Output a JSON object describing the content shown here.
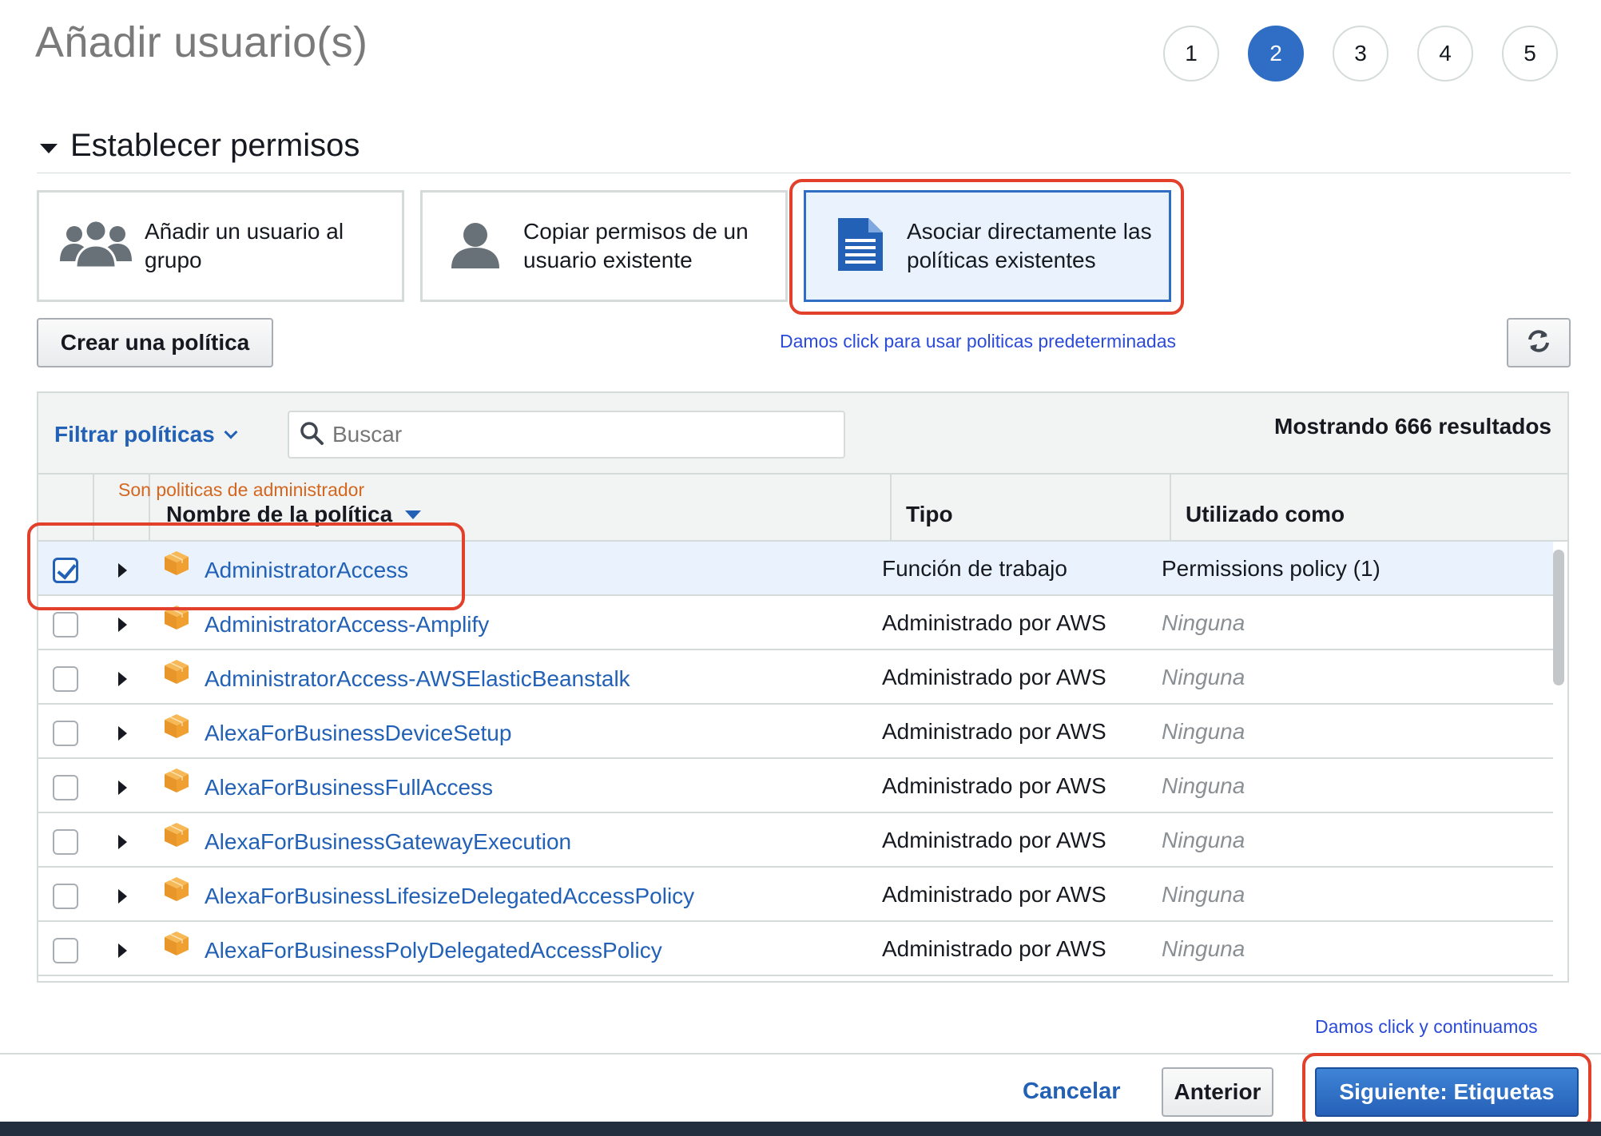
{
  "page": {
    "title": "Añadir usuario(s)"
  },
  "steps": [
    {
      "label": "1",
      "active": false
    },
    {
      "label": "2",
      "active": true
    },
    {
      "label": "3",
      "active": false
    },
    {
      "label": "4",
      "active": false
    },
    {
      "label": "5",
      "active": false
    }
  ],
  "permissions": {
    "section_title": "Establecer permisos",
    "options": [
      {
        "label_line1": "Añadir un usuario al",
        "label_line2": "grupo",
        "icon": "group-icon",
        "selected": false
      },
      {
        "label_line1": "Copiar permisos de un",
        "label_line2": "usuario existente",
        "icon": "user-icon",
        "selected": false
      },
      {
        "label_line1": "Asociar directamente las",
        "label_line2": "políticas existentes",
        "icon": "document-icon",
        "selected": true
      }
    ],
    "create_policy_label": "Crear una política",
    "refresh_icon": "refresh-icon"
  },
  "annotations": {
    "use_default_policies": "Damos click para usar politicas predeterminadas",
    "admin_policies": "Son politicas de administrador",
    "click_continue": "Damos click y continuamos"
  },
  "filter": {
    "label": "Filtrar políticas",
    "search_placeholder": "Buscar",
    "results_text": "Mostrando 666 resultados"
  },
  "table": {
    "columns": [
      "Nombre de la política",
      "Tipo",
      "Utilizado como"
    ],
    "rows": [
      {
        "name": "AdministratorAccess",
        "type": "Función de trabajo",
        "used_as": "Permissions policy (1)",
        "checked": true
      },
      {
        "name": "AdministratorAccess-Amplify",
        "type": "Administrado por AWS",
        "used_as": "Ninguna",
        "checked": false
      },
      {
        "name": "AdministratorAccess-AWSElasticBeanstalk",
        "type": "Administrado por AWS",
        "used_as": "Ninguna",
        "checked": false
      },
      {
        "name": "AlexaForBusinessDeviceSetup",
        "type": "Administrado por AWS",
        "used_as": "Ninguna",
        "checked": false
      },
      {
        "name": "AlexaForBusinessFullAccess",
        "type": "Administrado por AWS",
        "used_as": "Ninguna",
        "checked": false
      },
      {
        "name": "AlexaForBusinessGatewayExecution",
        "type": "Administrado por AWS",
        "used_as": "Ninguna",
        "checked": false
      },
      {
        "name": "AlexaForBusinessLifesizeDelegatedAccessPolicy",
        "type": "Administrado por AWS",
        "used_as": "Ninguna",
        "checked": false
      },
      {
        "name": "AlexaForBusinessPolyDelegatedAccessPolicy",
        "type": "Administrado por AWS",
        "used_as": "Ninguna",
        "checked": false
      }
    ]
  },
  "footer": {
    "cancel_label": "Cancelar",
    "previous_label": "Anterior",
    "next_label": "Siguiente: Etiquetas"
  },
  "colors": {
    "accent": "#2261b5",
    "primary_button": "#2f6ec4",
    "annotation_red": "#e3402c",
    "annotation_blue": "#2b4bd8",
    "annotation_orange": "#d4671f",
    "policy_icon": "#f0a030"
  }
}
